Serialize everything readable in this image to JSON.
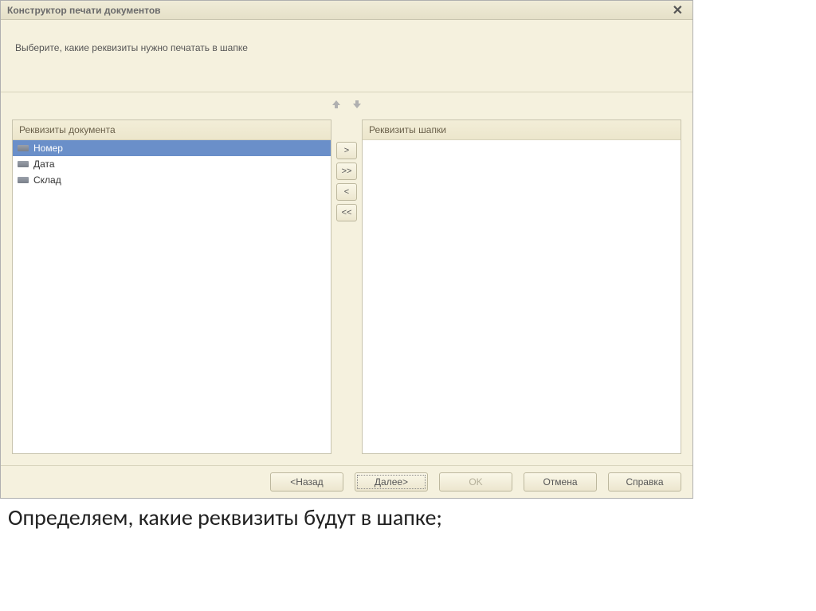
{
  "window": {
    "title": "Конструктор печати документов",
    "instruction": "Выберите, какие реквизиты нужно печатать в шапке"
  },
  "left_panel": {
    "header": "Реквизиты документа",
    "items": [
      {
        "label": "Номер",
        "selected": true
      },
      {
        "label": "Дата",
        "selected": false
      },
      {
        "label": "Склад",
        "selected": false
      }
    ]
  },
  "right_panel": {
    "header": "Реквизиты шапки"
  },
  "transfer": {
    "add": ">",
    "add_all": ">>",
    "remove": "<",
    "remove_all": "<<"
  },
  "buttons": {
    "back": "<Назад",
    "next": "Далее>",
    "ok": "OK",
    "cancel": "Отмена",
    "help": "Справка"
  },
  "footer": "Определяем, какие реквизиты будут в шапке;"
}
